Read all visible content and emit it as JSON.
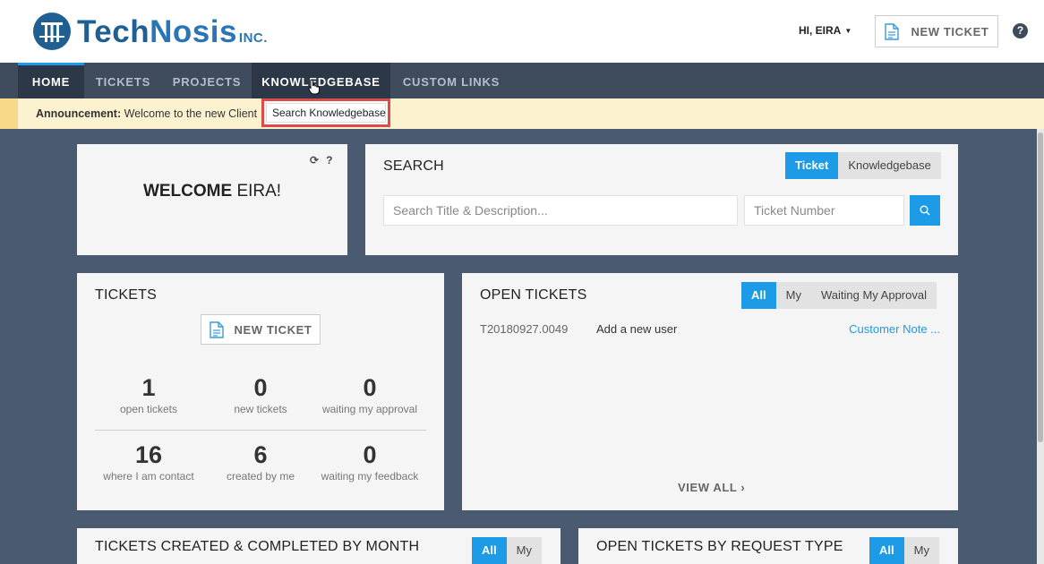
{
  "header": {
    "logo": {
      "tech": "Tech",
      "nosis": "Nosis",
      "inc": "INC."
    },
    "user_greeting": "HI, EIRA",
    "new_ticket_label": "NEW TICKET",
    "help_glyph": "?"
  },
  "nav": {
    "items": [
      {
        "label": "HOME",
        "state": "active"
      },
      {
        "label": "TICKETS"
      },
      {
        "label": "PROJECTS"
      },
      {
        "label": "KNOWLEDGEBASE",
        "state": "hover"
      },
      {
        "label": "CUSTOM LINKS"
      }
    ],
    "dropdown": {
      "item": "Search Knowledgebase"
    }
  },
  "announcement": {
    "label": "Announcement:",
    "text": "Welcome to the new Client"
  },
  "welcome": {
    "bold": "WELCOME",
    "name": "EIRA!",
    "icons": [
      "refresh-icon",
      "help-icon"
    ]
  },
  "search": {
    "title": "SEARCH",
    "toggle": [
      "Ticket",
      "Knowledgebase"
    ],
    "toggle_selected": "Ticket",
    "title_placeholder": "Search Title & Description...",
    "number_placeholder": "Ticket Number"
  },
  "tickets": {
    "title": "TICKETS",
    "new_ticket_label": "NEW TICKET",
    "stats": [
      {
        "value": "1",
        "label": "open tickets"
      },
      {
        "value": "0",
        "label": "new tickets"
      },
      {
        "value": "0",
        "label": "waiting my approval"
      },
      {
        "value": "16",
        "label": "where I am contact"
      },
      {
        "value": "6",
        "label": "created by me"
      },
      {
        "value": "0",
        "label": "waiting my feedback"
      }
    ]
  },
  "open_tickets": {
    "title": "OPEN TICKETS",
    "filters": [
      "All",
      "My",
      "Waiting My Approval"
    ],
    "filter_selected": "All",
    "rows": [
      {
        "id": "T20180927.0049",
        "description": "Add a new user",
        "note": "Customer Note ..."
      }
    ],
    "view_all": "VIEW ALL"
  },
  "chart_created": {
    "title": "TICKETS CREATED & COMPLETED BY MONTH",
    "filters": [
      "All",
      "My"
    ],
    "filter_selected": "All"
  },
  "chart_request_type": {
    "title": "OPEN TICKETS BY REQUEST TYPE",
    "filters": [
      "All",
      "My"
    ],
    "filter_selected": "All"
  },
  "colors": {
    "accent": "#1d9be6",
    "nav_bg": "#3f4c5e",
    "page_bg": "#4a5a70",
    "announcement_bg": "#fdf2cf",
    "highlight_border": "#e04a4a"
  }
}
